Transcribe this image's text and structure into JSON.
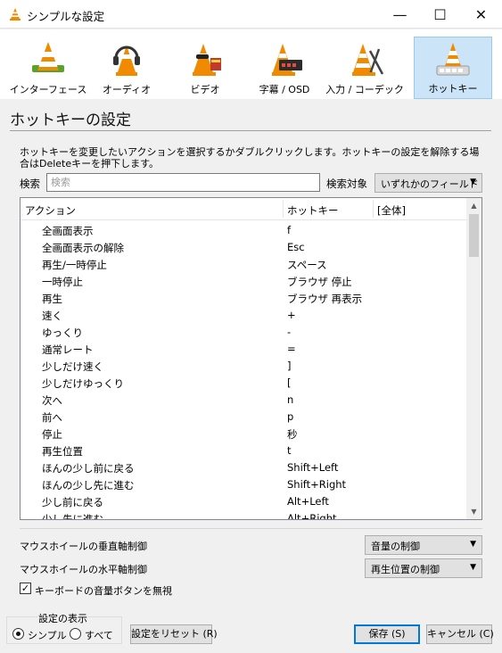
{
  "window": {
    "title": "シンプルな設定",
    "minimize": "—",
    "maximize": "☐",
    "close": "✕"
  },
  "toolbar": {
    "items": [
      {
        "label": "インターフェース"
      },
      {
        "label": "オーディオ"
      },
      {
        "label": "ビデオ"
      },
      {
        "label": "字幕 / OSD"
      },
      {
        "label": "入力 / コーデック"
      },
      {
        "label": "ホットキー",
        "selected": true
      }
    ]
  },
  "section": {
    "title": "ホットキーの設定"
  },
  "description": "ホットキーを変更したいアクションを選択するかダブルクリックします。ホットキーの設定を解除する場合はDeleteキーを押下します。",
  "search": {
    "label": "検索",
    "placeholder": "検索",
    "value": "",
    "target_label": "検索対象",
    "target_value": "いずれかのフィールド"
  },
  "table": {
    "columns": [
      "アクション",
      "ホットキー",
      "[全体]"
    ],
    "rows": [
      {
        "action": "全画面表示",
        "hotkey": "f"
      },
      {
        "action": "全画面表示の解除",
        "hotkey": "Esc"
      },
      {
        "action": "再生/一時停止",
        "hotkey": "スペース"
      },
      {
        "action": "一時停止",
        "hotkey": "ブラウザ 停止"
      },
      {
        "action": "再生",
        "hotkey": "ブラウザ 再表示"
      },
      {
        "action": "速く",
        "hotkey": "+"
      },
      {
        "action": "ゆっくり",
        "hotkey": "-"
      },
      {
        "action": "通常レート",
        "hotkey": "="
      },
      {
        "action": "少しだけ速く",
        "hotkey": "]"
      },
      {
        "action": "少しだけゆっくり",
        "hotkey": "["
      },
      {
        "action": "次へ",
        "hotkey": "n"
      },
      {
        "action": "前へ",
        "hotkey": "p"
      },
      {
        "action": "停止",
        "hotkey": "秒"
      },
      {
        "action": "再生位置",
        "hotkey": "t"
      },
      {
        "action": "ほんの少し前に戻る",
        "hotkey": "Shift+Left"
      },
      {
        "action": "ほんの少し先に進む",
        "hotkey": "Shift+Right"
      },
      {
        "action": "少し前に戻る",
        "hotkey": "Alt+Left"
      },
      {
        "action": "少し先に進む",
        "hotkey": "Alt+Right"
      }
    ]
  },
  "wheel": {
    "vertical_label": "マウスホイールの垂直軸制御",
    "vertical_value": "音量の制御",
    "horizontal_label": "マウスホイールの水平軸制御",
    "horizontal_value": "再生位置の制御"
  },
  "ignore_volume": {
    "label": "キーボードの音量ボタンを無視",
    "checked": true,
    "mark": "✓"
  },
  "display": {
    "title": "設定の表示",
    "simple": "シンプル",
    "all": "すべて",
    "selected": "simple"
  },
  "buttons": {
    "reset": "設定をリセット (R)",
    "save": "保存 (S)",
    "cancel": "キャンセル (C)"
  },
  "colors": {
    "cone_orange": "#f08a00",
    "selected_bg": "#cce4f7",
    "selected_border": "#99c9ef"
  }
}
